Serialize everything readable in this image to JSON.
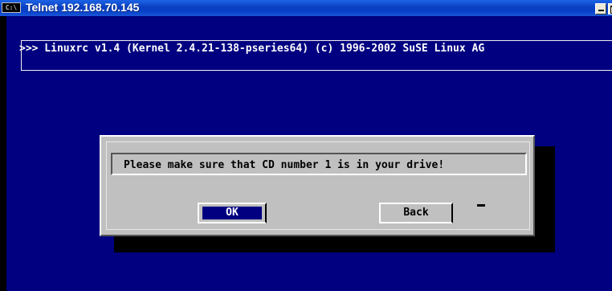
{
  "window": {
    "title": "Telnet 192.168.70.145",
    "icon_text": "C:\\"
  },
  "terminal": {
    "banner": ">>> Linuxrc v1.4 (Kernel 2.4.21-138-pseries64) (c) 1996-2002 SuSE Linux AG"
  },
  "dialog": {
    "message": "Please make sure that CD number 1 is in your drive!",
    "ok_label": "OK",
    "back_label": "Back"
  },
  "colors": {
    "terminal_background": "#000080",
    "dialog_background": "#c0c0c0",
    "title_bar": "#0a3fc2"
  }
}
